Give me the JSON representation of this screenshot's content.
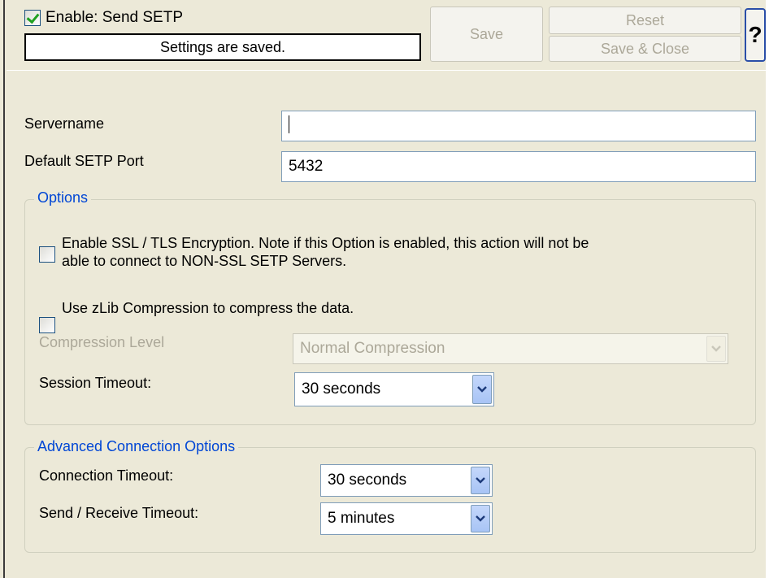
{
  "header": {
    "enable_label": "Enable: Send SETP",
    "enable_checked": true,
    "status_text": "Settings are saved.",
    "save_label": "Save",
    "reset_label": "Reset",
    "save_close_label": "Save & Close",
    "help_label": "?"
  },
  "form": {
    "servername_label": "Servername",
    "servername_value": "",
    "port_label": "Default SETP Port",
    "port_value": "5432"
  },
  "options": {
    "title": "Options",
    "ssl_label_line1": "Enable SSL / TLS Encryption. Note if this Option is enabled, this action will not be",
    "ssl_label_line2": "able to connect to NON-SSL SETP Servers.",
    "ssl_checked": false,
    "zlib_label": "Use zLib Compression to compress the data.",
    "zlib_checked": false,
    "compression_level_label": "Compression Level",
    "compression_level_value": "Normal Compression",
    "session_timeout_label": "Session Timeout:",
    "session_timeout_value": "30 seconds"
  },
  "advanced": {
    "title": "Advanced Connection Options",
    "connection_timeout_label": "Connection Timeout:",
    "connection_timeout_value": "30 seconds",
    "send_receive_timeout_label": "Send / Receive Timeout:",
    "send_receive_timeout_value": "5 minutes"
  },
  "colors": {
    "background": "#ece9d8",
    "group_title": "#0046d5",
    "disabled_text": "#aca899",
    "check_mark": "#21a121"
  }
}
